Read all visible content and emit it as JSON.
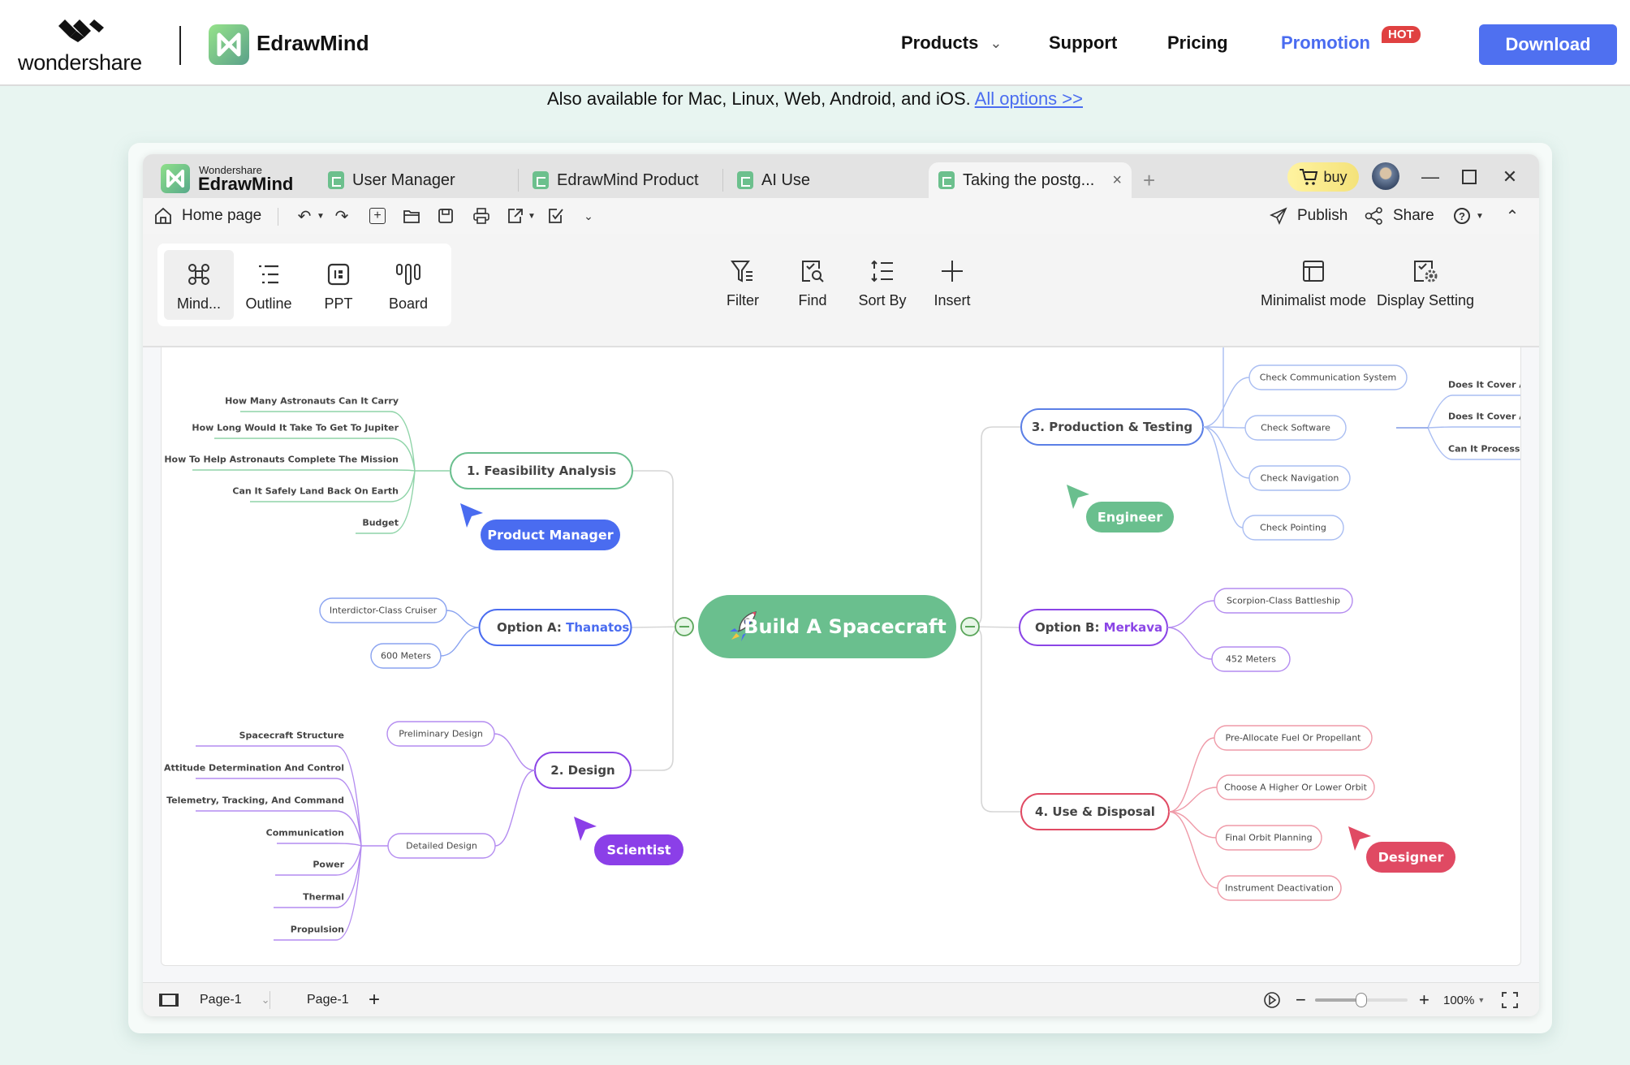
{
  "site": {
    "brand": "wondershare",
    "product": "EdrawMind",
    "nav": {
      "products": "Products",
      "support": "Support",
      "pricing": "Pricing",
      "promotion": "Promotion",
      "hot": "HOT",
      "download": "Download"
    },
    "banner_text": "Also available for Mac, Linux, Web, Android, and iOS.",
    "banner_link": "All options >>",
    "colors": {
      "accent": "#4f70f0",
      "hot": "#e04141",
      "background": "#e8f5f1"
    }
  },
  "app": {
    "brand_small": "Wondershare",
    "brand_big": "EdrawMind",
    "tabs": [
      {
        "label": "User Manager"
      },
      {
        "label": "EdrawMind Product"
      },
      {
        "label": "AI Use"
      },
      {
        "label": "Taking the postg...",
        "active": true
      }
    ],
    "buy_label": "buy",
    "toolbar": {
      "home": "Home page",
      "publish": "Publish",
      "share": "Share"
    },
    "views": [
      {
        "label": "Mind...",
        "icon": "mindmap-icon",
        "selected": true
      },
      {
        "label": "Outline",
        "icon": "outline-icon"
      },
      {
        "label": "PPT",
        "icon": "ppt-icon"
      },
      {
        "label": "Board",
        "icon": "board-icon"
      }
    ],
    "tools": [
      {
        "label": "Filter",
        "icon": "filter-icon"
      },
      {
        "label": "Find",
        "icon": "find-icon"
      },
      {
        "label": "Sort By",
        "icon": "sort-icon"
      },
      {
        "label": "Insert",
        "icon": "plus-icon"
      }
    ],
    "right_tools": [
      {
        "label": "Minimalist mode",
        "icon": "layout-icon"
      },
      {
        "label": "Display Setting",
        "icon": "display-setting-icon"
      }
    ],
    "status": {
      "page_select": "Page-1",
      "page_tab": "Page-1",
      "zoom": "100%",
      "zoom_fraction": 0.5
    }
  },
  "mindmap": {
    "root": "Build A Spacecraft",
    "colors": {
      "root": "#6abf8e",
      "feasibility": "#6abf8e",
      "optionA": "#4a6cf0",
      "design": "#8b45e6",
      "production": "#5b7fe6",
      "optionB": "#8b45e6",
      "use": "#e04a63"
    },
    "feasibility": {
      "label": "1. Feasibility Analysis",
      "children": [
        "How Many Astronauts Can It Carry",
        "How Long Would It Take To Get To Jupiter",
        "How To Help Astronauts Complete The Mission",
        "Can It Safely Land Back On Earth",
        "Budget"
      ]
    },
    "optionA": {
      "prefix": "Option A: ",
      "name": "Thanatos",
      "children": [
        "Interdictor-Class Cruiser",
        "600 Meters"
      ]
    },
    "design": {
      "label": "2. Design",
      "preliminary": "Preliminary Design",
      "detailed": "Detailed Design",
      "detailed_children": [
        "Spacecraft Structure",
        "Attitude Determination And Control",
        "Telemetry, Tracking, And Command",
        "Communication",
        "Power",
        "Thermal",
        "Propulsion"
      ]
    },
    "production": {
      "label": "3. Production & Testing",
      "children": [
        "Check Communication System",
        "Check Software",
        "Check Navigation",
        "Check Pointing"
      ],
      "software_children": [
        "Does It Cover All (",
        "Does It Cover All I",
        "Can It Process Inf"
      ]
    },
    "optionB": {
      "prefix": "Option B: ",
      "name": "Merkava",
      "children": [
        "Scorpion-Class Battleship",
        "452 Meters"
      ]
    },
    "use": {
      "label": "4. Use & Disposal",
      "children": [
        "Pre-Allocate Fuel Or Propellant",
        "Choose A Higher Or Lower Orbit",
        "Final Orbit Planning",
        "Instrument Deactivation"
      ]
    },
    "cursors": [
      {
        "label": "Product Manager",
        "color": "#4a6cf0"
      },
      {
        "label": "Scientist",
        "color": "#8b3fe8"
      },
      {
        "label": "Engineer",
        "color": "#6abf8e"
      },
      {
        "label": "Designer",
        "color": "#e04a63"
      }
    ]
  }
}
